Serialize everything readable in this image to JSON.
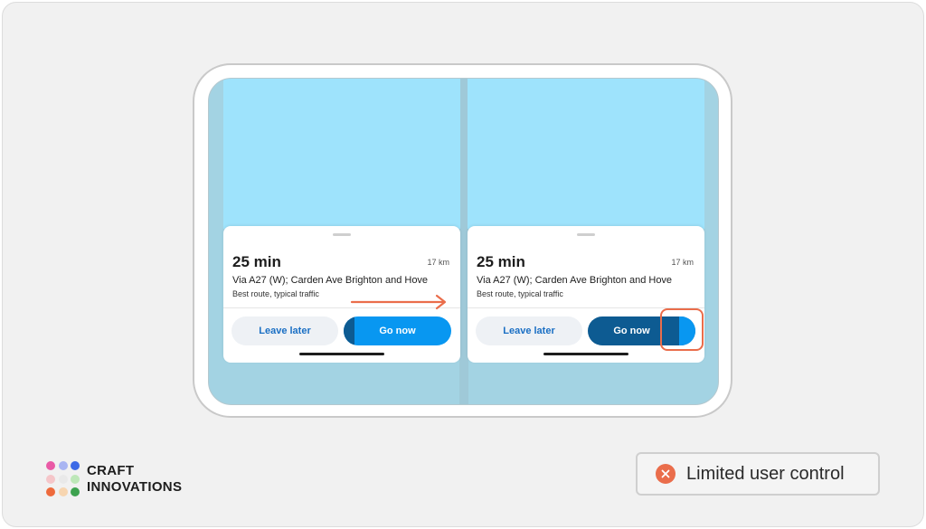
{
  "panes": [
    {
      "eta": "25 min",
      "distance": "17 km",
      "via": "Via A27 (W); Carden Ave Brighton and Hove",
      "note": "Best route, typical traffic",
      "leave_later_label": "Leave later",
      "go_now_label": "Go now"
    },
    {
      "eta": "25 min",
      "distance": "17 km",
      "via": "Via A27 (W); Carden Ave Brighton and Hove",
      "note": "Best route, typical traffic",
      "leave_later_label": "Leave later",
      "go_now_label": "Go now"
    }
  ],
  "brand": {
    "line1": "CRAFT",
    "line2": "INNOVATIONS",
    "dot_colors": [
      "#e95aa6",
      "#a9b5f2",
      "#3d6ae6",
      "#f5c6c9",
      "#e9e9e9",
      "#bde7b8",
      "#ee6a3c",
      "#f7d5b0",
      "#3da24f"
    ]
  },
  "verdict": {
    "label": "Limited user control",
    "icon": "close-circle-icon"
  },
  "colors": {
    "accent_blue": "#0897f1",
    "dark_blue": "#0d5b92",
    "annotation_orange": "#ea6d4b",
    "map_blue": "#9ee3fc"
  }
}
